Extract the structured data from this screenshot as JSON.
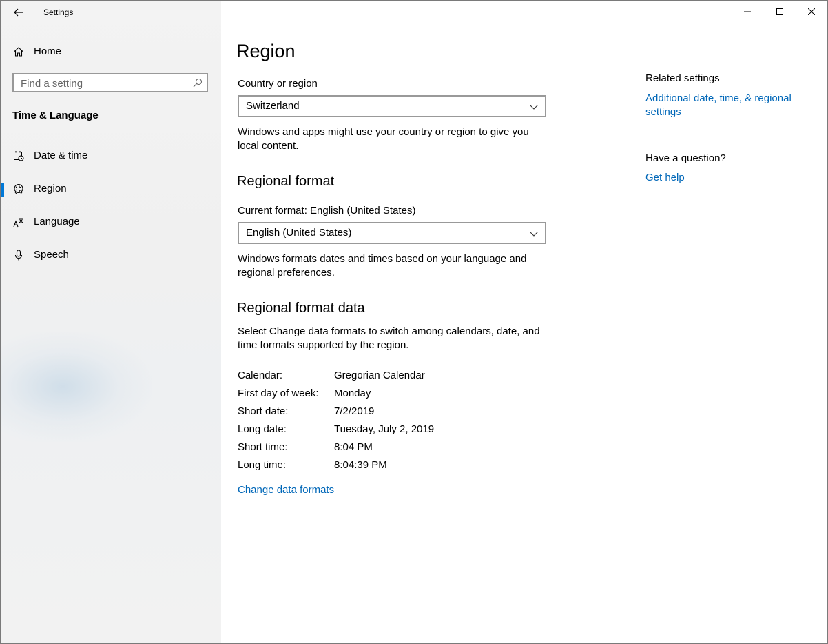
{
  "window": {
    "title": "Settings"
  },
  "sidebar": {
    "home_label": "Home",
    "search_placeholder": "Find a setting",
    "section_title": "Time & Language",
    "items": [
      {
        "label": "Date & time",
        "icon": "calendar-clock-icon",
        "selected": false
      },
      {
        "label": "Region",
        "icon": "globe-icon",
        "selected": true
      },
      {
        "label": "Language",
        "icon": "language-icon",
        "selected": false
      },
      {
        "label": "Speech",
        "icon": "microphone-icon",
        "selected": false
      }
    ]
  },
  "main": {
    "title": "Region",
    "country": {
      "label": "Country or region",
      "value": "Switzerland",
      "description": "Windows and apps might use your country or region to give you local content."
    },
    "regional_format": {
      "heading": "Regional format",
      "current_label": "Current format: English (United States)",
      "value": "English (United States)",
      "description": "Windows formats dates and times based on your language and regional preferences."
    },
    "format_data": {
      "heading": "Regional format data",
      "description": "Select Change data formats to switch among calendars, date, and time formats supported by the region.",
      "rows": [
        {
          "key": "Calendar:",
          "value": "Gregorian Calendar"
        },
        {
          "key": "First day of week:",
          "value": "Monday"
        },
        {
          "key": "Short date:",
          "value": "7/2/2019"
        },
        {
          "key": "Long date:",
          "value": "Tuesday, July 2, 2019"
        },
        {
          "key": "Short time:",
          "value": "8:04 PM"
        },
        {
          "key": "Long time:",
          "value": "8:04:39 PM"
        }
      ],
      "change_link": "Change data formats"
    }
  },
  "related": {
    "heading": "Related settings",
    "link1": "Additional date, time, & regional settings",
    "question": "Have a question?",
    "help_link": "Get help"
  },
  "colors": {
    "accent": "#0078d7",
    "link": "#0067b8"
  }
}
